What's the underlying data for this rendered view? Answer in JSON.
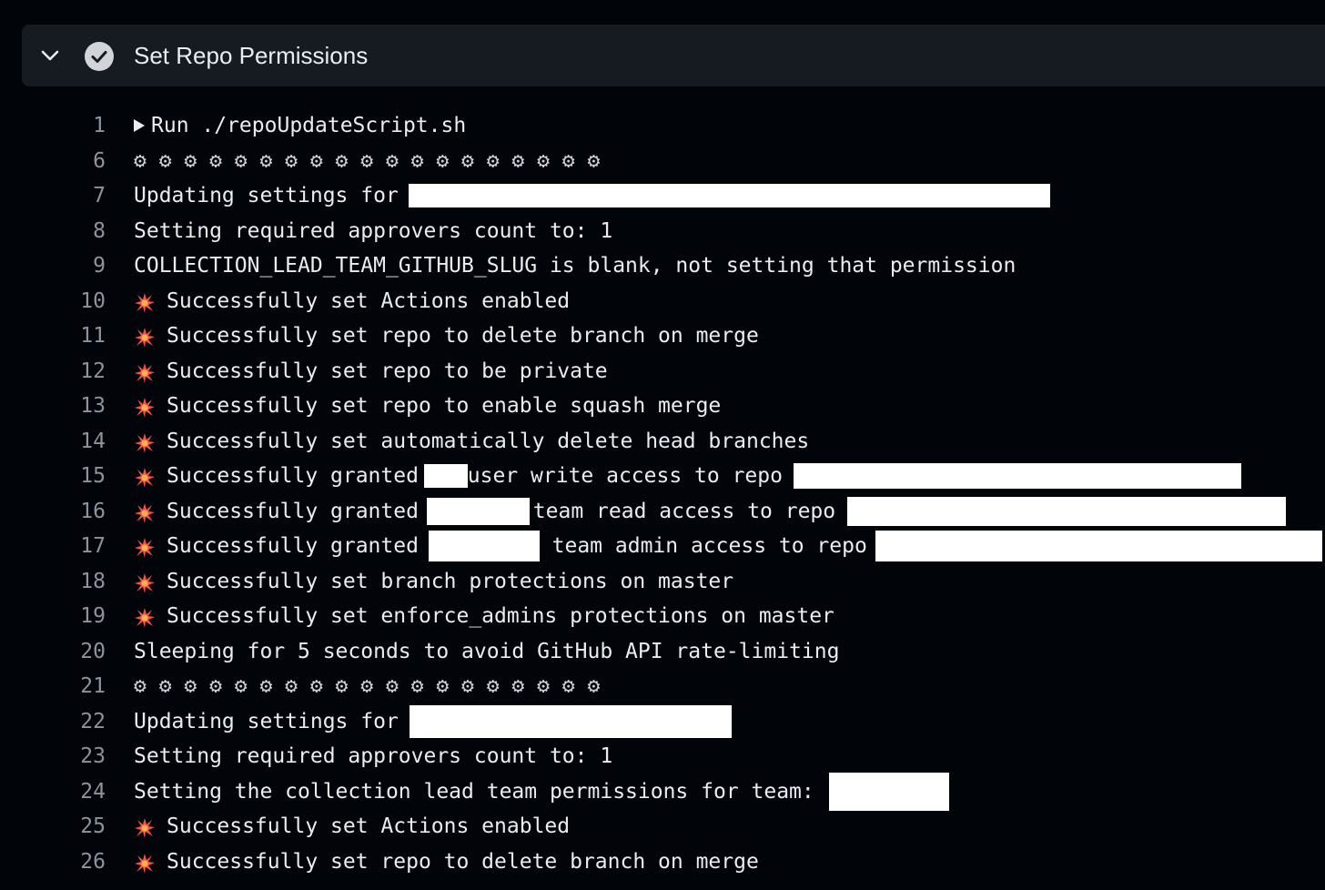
{
  "header": {
    "title": "Set Repo Permissions"
  },
  "lines": [
    {
      "n": "1",
      "parts": [
        "Run ./repoUpdateScript.sh"
      ]
    },
    {
      "n": "6",
      "parts": [
        "⚙ ⚙ ⚙ ⚙ ⚙ ⚙ ⚙ ⚙ ⚙ ⚙ ⚙ ⚙ ⚙ ⚙ ⚙ ⚙ ⚙ ⚙ ⚙"
      ]
    },
    {
      "n": "7",
      "parts": [
        "Updating settings for "
      ]
    },
    {
      "n": "8",
      "parts": [
        "Setting required approvers count to: 1"
      ]
    },
    {
      "n": "9",
      "parts": [
        "COLLECTION_LEAD_TEAM_GITHUB_SLUG is blank, not setting that permission"
      ]
    },
    {
      "n": "10",
      "parts": [
        "Successfully set Actions enabled"
      ]
    },
    {
      "n": "11",
      "parts": [
        "Successfully set repo to delete branch on merge"
      ]
    },
    {
      "n": "12",
      "parts": [
        "Successfully set repo to be private"
      ]
    },
    {
      "n": "13",
      "parts": [
        "Successfully set repo to enable squash merge"
      ]
    },
    {
      "n": "14",
      "parts": [
        "Successfully set automatically delete head branches"
      ]
    },
    {
      "n": "15",
      "parts": [
        "Successfully granted ",
        "user write access to repo "
      ]
    },
    {
      "n": "16",
      "parts": [
        "Successfully granted ",
        "team read access to repo "
      ]
    },
    {
      "n": "17",
      "parts": [
        "Successfully granted ",
        " team admin access to repo "
      ]
    },
    {
      "n": "18",
      "parts": [
        "Successfully set branch protections on master"
      ]
    },
    {
      "n": "19",
      "parts": [
        "Successfully set enforce_admins protections on master"
      ]
    },
    {
      "n": "20",
      "parts": [
        "Sleeping for 5 seconds to avoid GitHub API rate-limiting"
      ]
    },
    {
      "n": "21",
      "parts": [
        "⚙ ⚙ ⚙ ⚙ ⚙ ⚙ ⚙ ⚙ ⚙ ⚙ ⚙ ⚙ ⚙ ⚙ ⚙ ⚙ ⚙ ⚙ ⚙"
      ]
    },
    {
      "n": "22",
      "parts": [
        "Updating settings for "
      ]
    },
    {
      "n": "23",
      "parts": [
        "Setting required approvers count to: 1"
      ]
    },
    {
      "n": "24",
      "parts": [
        "Setting the collection lead team permissions for team: "
      ]
    },
    {
      "n": "25",
      "parts": [
        "Successfully set Actions enabled"
      ]
    },
    {
      "n": "26",
      "parts": [
        "Successfully set repo to delete branch on merge"
      ]
    }
  ],
  "icons": {
    "chevron": "chevron-down-icon",
    "status": "check-circle-icon",
    "expand": "triangle-right-icon",
    "success": "collision-spark-icon"
  },
  "colors": {
    "background": "#010409",
    "header": "#161b22",
    "text": "#e6edf3",
    "line_number": "#8b949e",
    "spark_red": "#f85149",
    "spark_orange": "#ffb347"
  }
}
